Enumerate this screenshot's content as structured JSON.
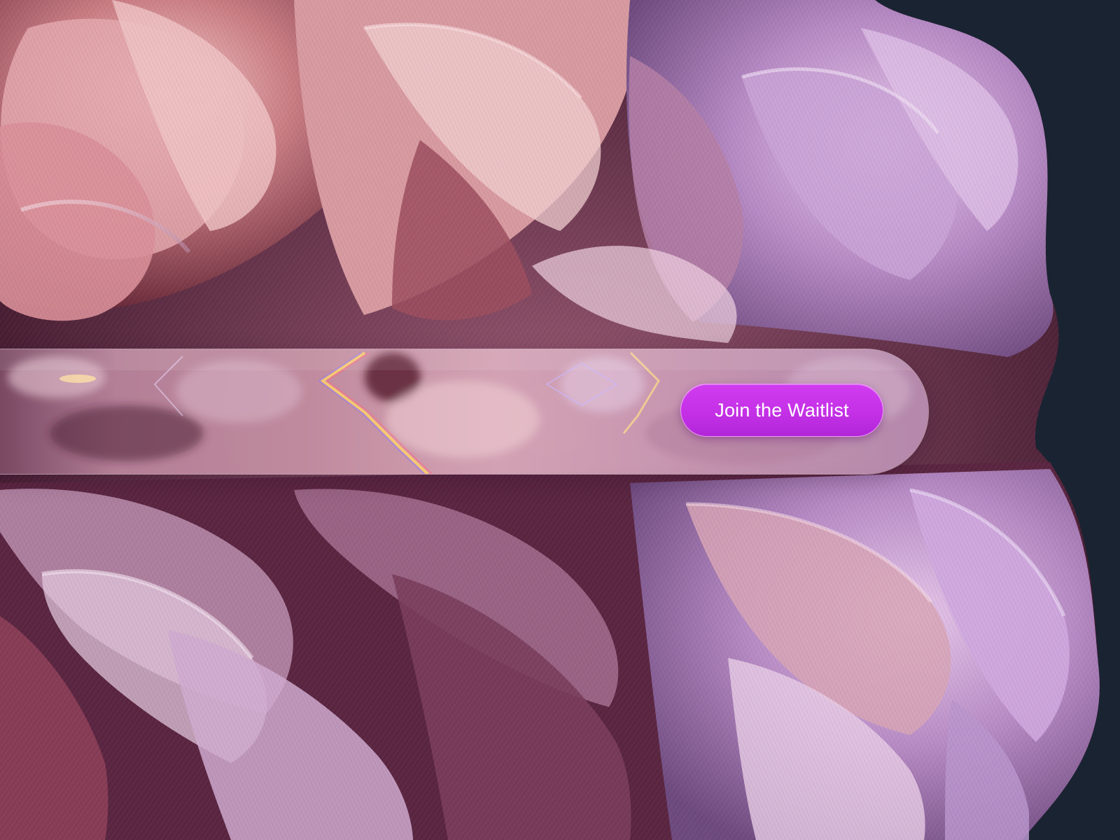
{
  "background": {
    "color": "#1a2332",
    "artwork_icon": "peony-flower-artwork"
  },
  "banner": {
    "glass_icon": "refracted-glass-strip",
    "cta": {
      "label": "Join the Waitlist",
      "color": "#c935ea"
    }
  }
}
